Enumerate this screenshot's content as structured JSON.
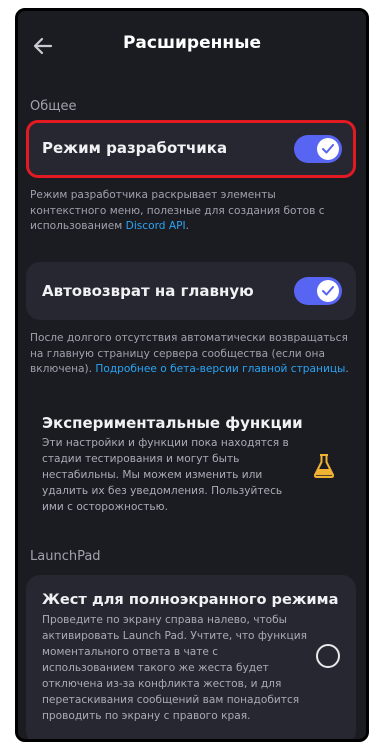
{
  "header": {
    "title": "Расширенные",
    "back_icon": "arrow-left-icon"
  },
  "sections": {
    "general": "Общее",
    "launchpad": "LaunchPad"
  },
  "developer_mode": {
    "label": "Режим разработчика",
    "enabled": true,
    "description": "Режим разработчика раскрывает элементы контекстного меню, полезные для создания ботов с использованием ",
    "link": "Discord API",
    "link_suffix": "."
  },
  "auto_return": {
    "label": "Автовозврат на главную",
    "enabled": true,
    "description": "После долгого отсутствия автоматически возвращаться на главную страницу сервера сообщества (если она включена). ",
    "link": "Подробнее о бета-версии главной страницы",
    "link_suffix": "."
  },
  "experimental": {
    "title": "Экспериментальные функции",
    "description": "Эти настройки и функции пока находятся в стадии тестирования и могут быть нестабильны. Мы можем изменить или удалить их без уведомления. Пользуйтесь ими с осторожностью.",
    "icon": "flask-icon"
  },
  "gesture": {
    "title": "Жест для полноэкранного режима",
    "description": "Проведите по экрану справа налево, чтобы активировать Launch Pad. Учтите, что функция моментального ответа в чате с использованием такого же жеста будет отключена из-за конфликта жестов, и для перетаскивания сообщений вам понадобится проводить по экрану с правого края.",
    "selected": false
  },
  "colors": {
    "accent": "#5865f2",
    "link": "#2aa4f4",
    "highlight": "#e41a23",
    "background": "#1b1c22",
    "card": "#262730",
    "flask": "#f0b232"
  }
}
